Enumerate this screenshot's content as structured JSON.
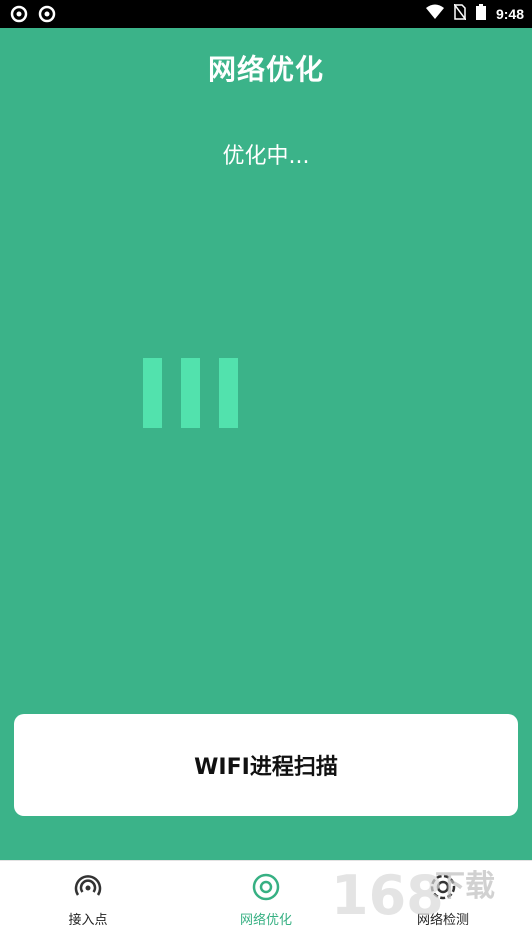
{
  "status_bar": {
    "time": "9:48",
    "icons": [
      "sync-icon",
      "sync-icon",
      "wifi-icon",
      "no-sim-icon",
      "battery-icon"
    ]
  },
  "header": {
    "title": "网络优化",
    "status": "优化中..."
  },
  "action": {
    "scan_label": "WIFI进程扫描"
  },
  "bottom_nav": {
    "items": [
      {
        "label": "接入点",
        "icon": "access-point-icon",
        "active": false
      },
      {
        "label": "网络优化",
        "icon": "optimize-icon",
        "active": true
      },
      {
        "label": "网络检测",
        "icon": "settings-gear-icon",
        "active": false
      }
    ]
  },
  "watermark": {
    "text": "168下载"
  },
  "colors": {
    "background": "#3bb389",
    "loader": "#52e2ad",
    "active_nav": "#37b083"
  }
}
